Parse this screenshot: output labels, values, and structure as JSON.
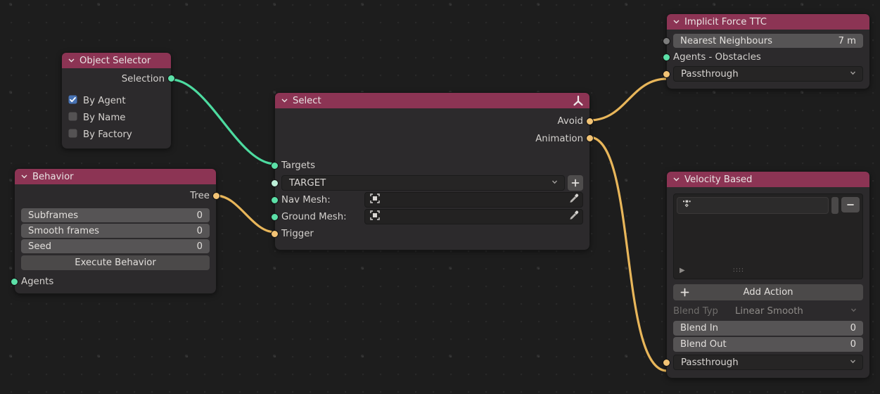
{
  "app": {
    "editor": "node-editor",
    "background_color": "#1d1d1d"
  },
  "colors": {
    "header": "#8c3454",
    "node_body": "#2c2a2c",
    "socket_teal": "#5ce0a8",
    "socket_orange": "#f2c375",
    "socket_grey": "#7d7d7d",
    "link_teal": "#4ddba0",
    "link_orange": "#e8b65a",
    "checkbox_on": "#4772b3"
  },
  "nodes": {
    "object_selector": {
      "title": "Object Selector",
      "outputs": [
        {
          "label": "Selection",
          "socket": "teal"
        }
      ],
      "checkboxes": [
        {
          "label": "By Agent",
          "checked": true
        },
        {
          "label": "By Name",
          "checked": false
        },
        {
          "label": "By Factory",
          "checked": false
        }
      ]
    },
    "behavior": {
      "title": "Behavior",
      "outputs": [
        {
          "label": "Tree",
          "socket": "orange"
        }
      ],
      "fields": [
        {
          "label": "Subframes",
          "value": "0"
        },
        {
          "label": "Smooth frames",
          "value": "0"
        },
        {
          "label": "Seed",
          "value": "0"
        }
      ],
      "button": "Execute Behavior",
      "inputs": [
        {
          "label": "Agents",
          "socket": "teal"
        }
      ]
    },
    "select": {
      "title": "Select",
      "header_icon": "empty-axes-icon",
      "outputs": [
        {
          "label": "Avoid",
          "socket": "orange"
        },
        {
          "label": "Animation",
          "socket": "orange"
        }
      ],
      "inputs": [
        {
          "label": "Targets",
          "socket": "teal"
        },
        {
          "label": "Trigger",
          "socket": "orange"
        }
      ],
      "target_dropdown": {
        "value": "TARGET",
        "add_label": "+"
      },
      "mesh_fields": [
        {
          "label": "Nav Mesh:",
          "value": "",
          "socket": "teal"
        },
        {
          "label": "Ground Mesh:",
          "value": "",
          "socket": "teal"
        }
      ]
    },
    "implicit_force_ttc": {
      "title": "Implicit Force TTC",
      "slider": {
        "label": "Nearest Neighbours",
        "value": "7 m",
        "socket": "grey"
      },
      "input": {
        "label": "Agents - Obstacles",
        "socket": "teal"
      },
      "dropdown": {
        "value": "Passthrough",
        "socket": "orange"
      }
    },
    "velocity_based": {
      "title": "Velocity Based",
      "list": {
        "item_icon": "action-icon",
        "remove_label": "−",
        "play_label": "▶",
        "grip": "::::"
      },
      "add_action": {
        "label": "Add Action",
        "icon": "plus-icon"
      },
      "blend_type": {
        "label": "Blend Typ",
        "value": "Linear Smooth"
      },
      "fields": [
        {
          "label": "Blend In",
          "value": "0"
        },
        {
          "label": "Blend Out",
          "value": "0"
        }
      ],
      "dropdown": {
        "value": "Passthrough",
        "socket": "orange"
      }
    }
  },
  "links": [
    {
      "from": "object_selector.Selection",
      "to": "select.Targets",
      "color": "#4ddba0"
    },
    {
      "from": "behavior.Tree",
      "to": "select.Trigger",
      "color": "#e8b65a"
    },
    {
      "from": "select.Avoid",
      "to": "implicit_force_ttc.Passthrough",
      "color": "#e8b65a"
    },
    {
      "from": "select.Animation",
      "to": "velocity_based.Passthrough",
      "color": "#e8b65a"
    }
  ]
}
